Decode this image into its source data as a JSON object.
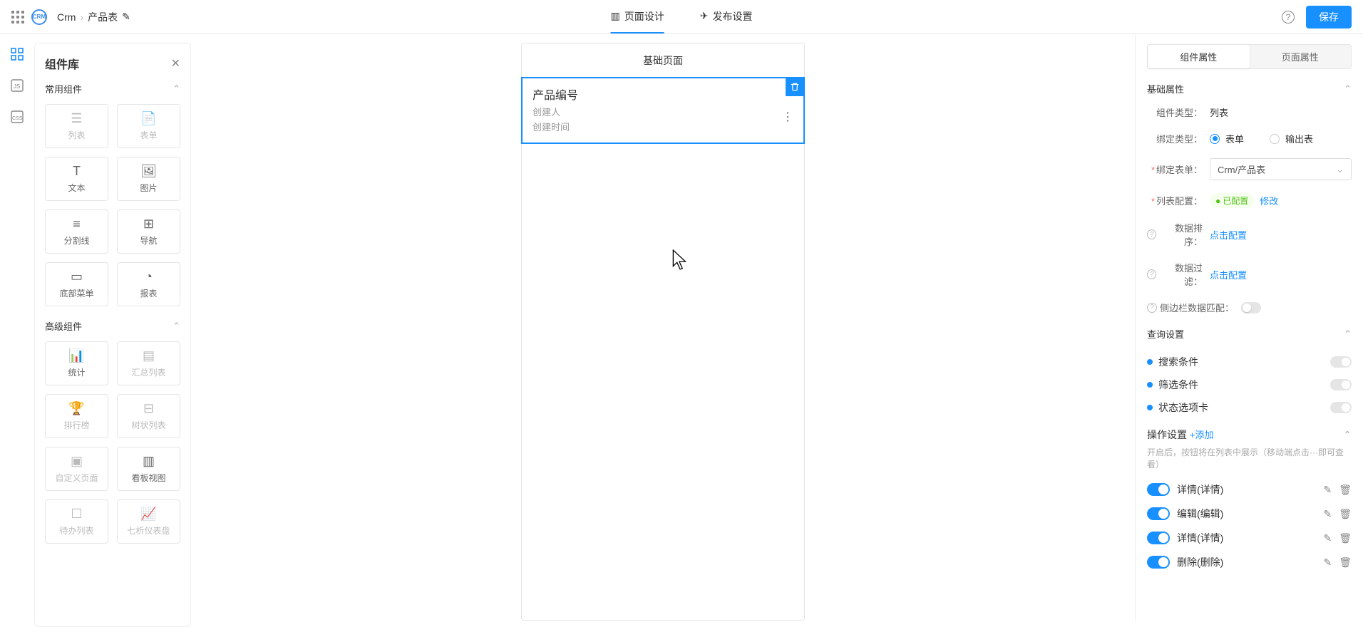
{
  "header": {
    "breadcrumb1": "Crm",
    "breadcrumb2": "产品表",
    "tab1": "页面设计",
    "tab2": "发布设置",
    "save": "保存"
  },
  "compLib": {
    "title": "组件库",
    "section1": "常用组件",
    "section2": "高级组件",
    "items1": [
      "列表",
      "表单",
      "文本",
      "图片",
      "分割线",
      "导航",
      "底部菜单",
      "报表"
    ],
    "items2": [
      "统计",
      "汇总列表",
      "排行榜",
      "树状列表",
      "自定义页面",
      "看板视图",
      "待办列表",
      "七析仪表盘"
    ]
  },
  "canvas": {
    "pageTitle": "基础页面",
    "blockTitle": "产品编号",
    "sub1": "创建人",
    "sub2": "创建时间"
  },
  "panel": {
    "tab1": "组件属性",
    "tab2": "页面属性",
    "section1": "基础属性",
    "compTypeLabel": "组件类型：",
    "compTypeValue": "列表",
    "bindTypeLabel": "绑定类型：",
    "bindType1": "表单",
    "bindType2": "输出表",
    "bindFormLabel": "绑定表单：",
    "bindFormValue": "Crm/产品表",
    "listConfigLabel": "列表配置：",
    "configured": "已配置",
    "modify": "修改",
    "dataSortLabel": "数据排序：",
    "dataFilterLabel": "数据过滤：",
    "clickConfig": "点击配置",
    "sidebarMatchLabel": "侧边栏数据匹配：",
    "section2": "查询设置",
    "query1": "搜索条件",
    "query2": "筛选条件",
    "query3": "状态选项卡",
    "section3": "操作设置",
    "add": "+添加",
    "hint": "开启后，按钮将在列表中展示（移动端点击···即可查看）",
    "actions": [
      "详情(详情)",
      "编辑(编辑)",
      "详情(详情)",
      "删除(删除)"
    ]
  }
}
